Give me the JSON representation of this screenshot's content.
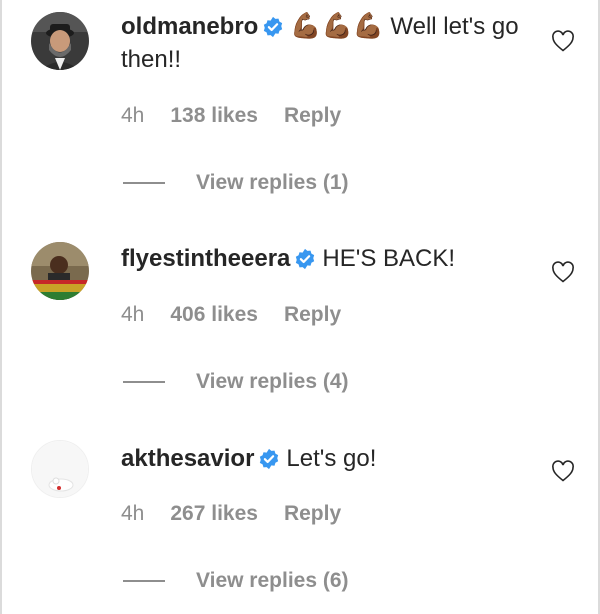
{
  "comments": [
    {
      "username": "oldmanebro",
      "emoji": "💪🏾💪🏾💪🏾",
      "text": " Well let's go then!!",
      "time": "4h",
      "likes": "138 likes",
      "reply": "Reply",
      "view_replies": "View replies (1)",
      "avatar_icon": "bearded-man-avatar"
    },
    {
      "username": "flyestintheeera",
      "emoji": "",
      "text": "HE'S BACK!",
      "time": "4h",
      "likes": "406 likes",
      "reply": "Reply",
      "view_replies": "View replies (4)",
      "avatar_icon": "man-on-street-avatar"
    },
    {
      "username": "akthesavior",
      "emoji": "",
      "text": "Let's go!",
      "time": "4h",
      "likes": "267 likes",
      "reply": "Reply",
      "view_replies": "View replies (6)",
      "avatar_icon": "white-figure-avatar"
    }
  ],
  "colors": {
    "text": "#262626",
    "secondary": "#8e8e8e",
    "verified": "#3897f0",
    "border": "#dbdbdb"
  },
  "icons": {
    "verified": "verified-badge-icon",
    "like": "heart-outline-icon"
  }
}
